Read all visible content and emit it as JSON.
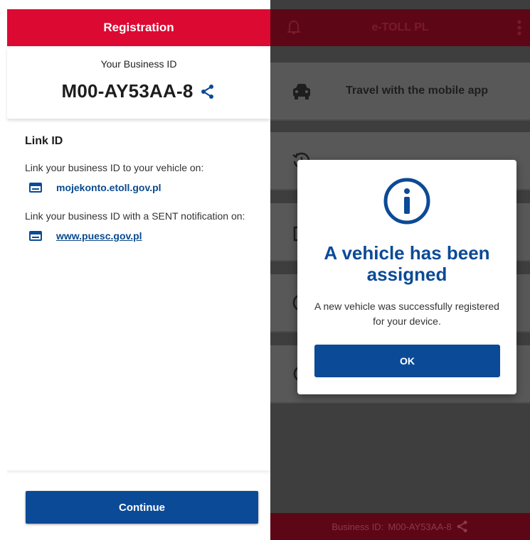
{
  "registration": {
    "header_title": "Registration",
    "business_id_label": "Your Business ID",
    "business_id": "M00-AY53AA-8",
    "link_title": "Link ID",
    "link_vehicle_text": "Link your business ID to your vehicle on:",
    "link_vehicle_url": "mojekonto.etoll.gov.pl",
    "link_sent_text": "Link your business ID with a SENT notification on:",
    "link_sent_url": "www.puesc.gov.pl",
    "continue_label": "Continue"
  },
  "app": {
    "title": "e-TOLL PL",
    "menu": [
      {
        "label": "Travel with the mobile app",
        "icon": "car-icon"
      },
      {
        "label": "",
        "icon": "history-icon"
      },
      {
        "label": "",
        "icon": "documents-icon"
      },
      {
        "label": "",
        "icon": "clock-icon"
      },
      {
        "label": "",
        "icon": "location-icon"
      }
    ],
    "footer_label": "Business ID:",
    "footer_business_id": "M00-AY53AA-8"
  },
  "dialog": {
    "title": "A vehicle has been assigned",
    "message": "A new vehicle was successfully registered for your device.",
    "ok_label": "OK"
  },
  "colors": {
    "red": "#dc0a33",
    "blue": "#0b4a96",
    "overlay_header": "#5d0716"
  }
}
